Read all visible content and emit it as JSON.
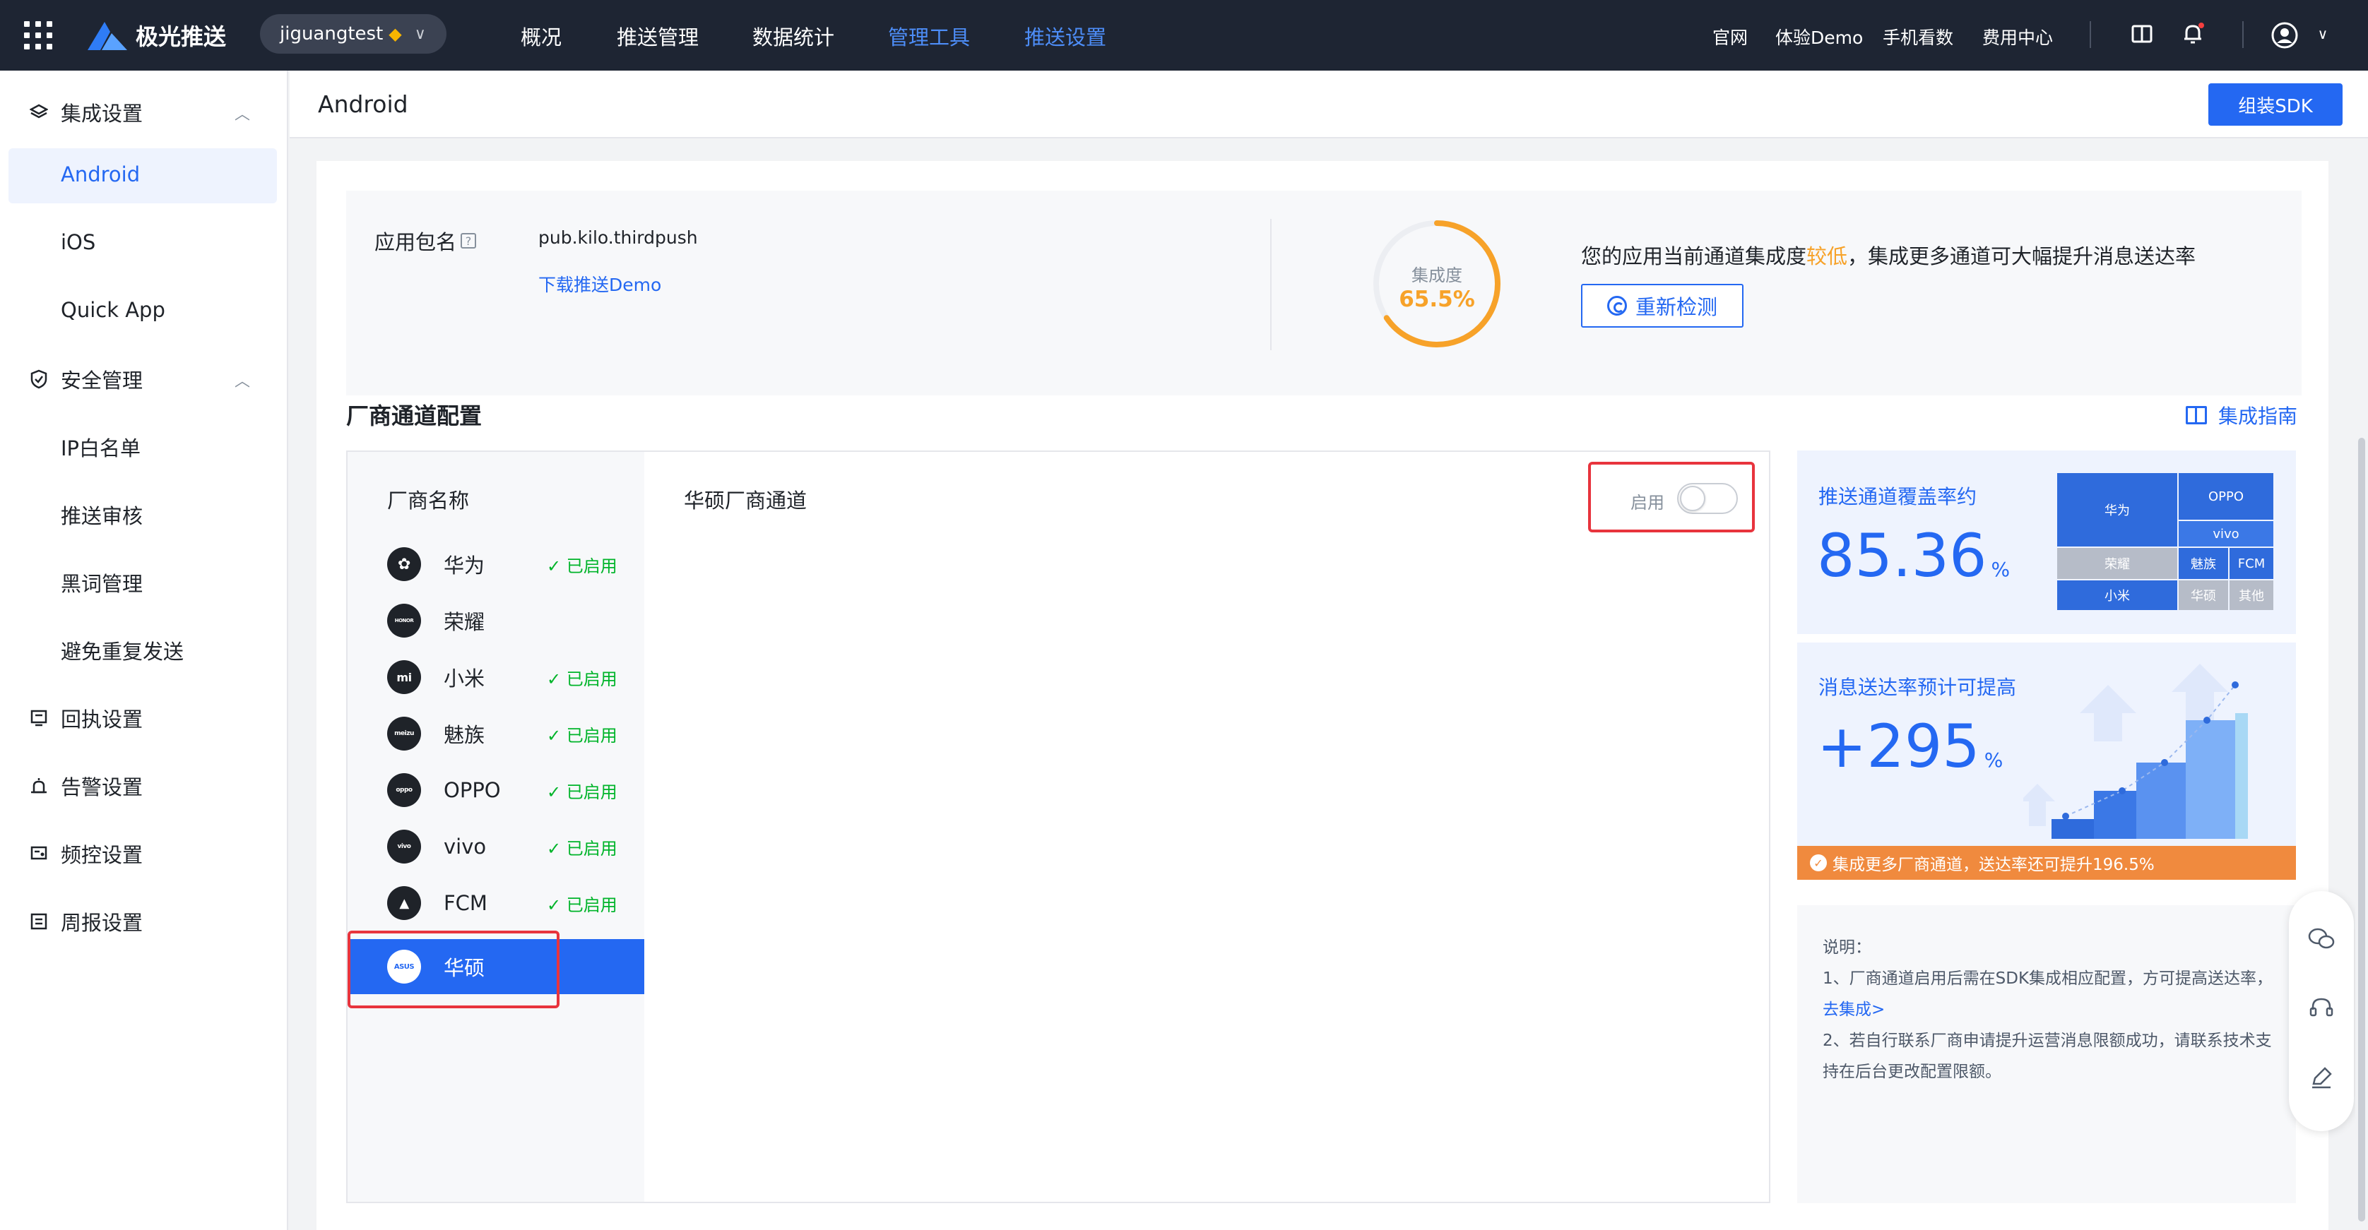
{
  "topbar": {
    "brand": "极光推送",
    "app_selector": "jiguangtest",
    "nav": [
      "概况",
      "推送管理",
      "数据统计",
      "管理工具",
      "推送设置"
    ],
    "utilities": [
      "官网",
      "体验Demo",
      "手机看数",
      "费用中心"
    ]
  },
  "sidebar": {
    "groups": [
      {
        "label": "集成设置",
        "icon": "layers-icon",
        "items": [
          "Android",
          "iOS",
          "Quick App"
        ]
      },
      {
        "label": "安全管理",
        "icon": "shield-icon",
        "items": [
          "IP白名单",
          "推送审核",
          "黑词管理",
          "避免重复发送"
        ]
      },
      {
        "label": "回执设置",
        "icon": "receipt-icon"
      },
      {
        "label": "告警设置",
        "icon": "alarm-icon"
      },
      {
        "label": "频控设置",
        "icon": "frequency-icon"
      },
      {
        "label": "周报设置",
        "icon": "report-icon"
      }
    ]
  },
  "page": {
    "title": "Android",
    "build_sdk_label": "组装SDK"
  },
  "app_info": {
    "package_label": "应用包名",
    "package_value": "pub.kilo.thirdpush",
    "demo_link": "下载推送Demo",
    "gauge_label": "集成度",
    "gauge_value": "65.5%",
    "gauge_fraction": 0.655,
    "message_prefix": "您的应用当前通道集成度",
    "message_level": "较低",
    "message_suffix": "，集成更多通道可大幅提升消息送达率",
    "recheck_label": "重新检测"
  },
  "vendor_section": {
    "title": "厂商通道配置",
    "guide_link": "集成指南",
    "list_header": "厂商名称",
    "enabled_text": "✓ 已启用",
    "vendors": [
      {
        "name": "华为",
        "logo": "huawei-logo",
        "logo_text": "✿",
        "enabled": true
      },
      {
        "name": "荣耀",
        "logo": "honor-logo",
        "logo_text": "HONOR",
        "enabled": false
      },
      {
        "name": "小米",
        "logo": "xiaomi-logo",
        "logo_text": "mi",
        "enabled": true
      },
      {
        "name": "魅族",
        "logo": "meizu-logo",
        "logo_text": "meizu",
        "enabled": true
      },
      {
        "name": "OPPO",
        "logo": "oppo-logo",
        "logo_text": "oppo",
        "enabled": true
      },
      {
        "name": "vivo",
        "logo": "vivo-logo",
        "logo_text": "vivo",
        "enabled": true
      },
      {
        "name": "FCM",
        "logo": "fcm-logo",
        "logo_text": "▲",
        "enabled": true
      },
      {
        "name": "华硕",
        "logo": "asus-logo",
        "logo_text": "ASUS",
        "enabled": false,
        "selected": true
      }
    ],
    "channel_title": "华硕厂商通道",
    "toggle_label": "启用",
    "toggle_on": false
  },
  "coverage": {
    "label": "推送通道覆盖率约",
    "value": "85.36",
    "unit": "%",
    "treemap": [
      {
        "name": "华为",
        "color": "#2f6bdc"
      },
      {
        "name": "OPPO",
        "color": "#2f6bdc"
      },
      {
        "name": "vivo",
        "color": "#3b78e6"
      },
      {
        "name": "荣耀",
        "color": "#b6bcc8"
      },
      {
        "name": "魅族",
        "color": "#2f6bdc"
      },
      {
        "name": "FCM",
        "color": "#2f6bdc"
      },
      {
        "name": "小米",
        "color": "#2f6bdc"
      },
      {
        "name": "华硕",
        "color": "#b6bcc8"
      },
      {
        "name": "其他",
        "color": "#b6bcc8"
      }
    ]
  },
  "rate": {
    "label": "消息送达率预计可提高",
    "value": "+295",
    "unit": "%",
    "banner": "集成更多厂商通道，送达率还可提升196.5%"
  },
  "notes": {
    "title": "说明：",
    "line1": "1、厂商通道启用后需在SDK集成相应配置，方可提高送达率，",
    "line1_link": "去集成>",
    "line2": "2、若自行联系厂商申请提升运营消息限额成功，请联系技术支持在后台更改配置限额。"
  },
  "colors": {
    "primary": "#2468f2",
    "warning": "#f7a229",
    "success": "#00b42a",
    "highlight": "#e8343d",
    "topbar": "#1e2533"
  }
}
